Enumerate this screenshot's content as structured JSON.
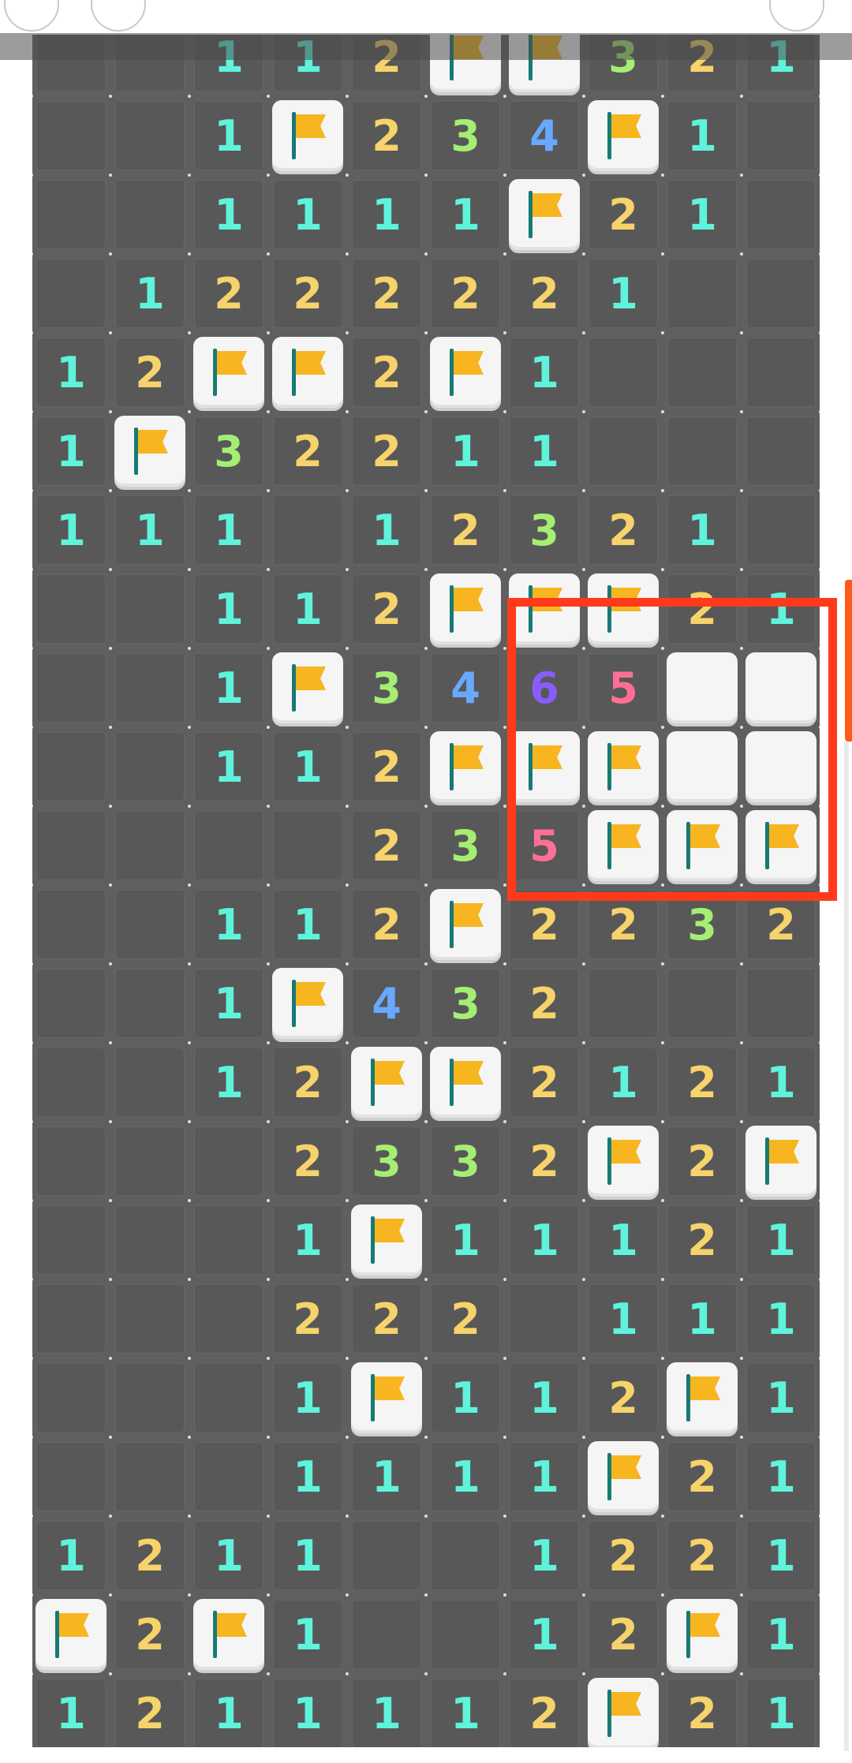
{
  "colors": {
    "1": "#5ff3dc",
    "2": "#f6d36b",
    "3": "#a5ee74",
    "4": "#68a9ff",
    "5": "#ff6f95",
    "6": "#8a5cff",
    "highlight": "#ff3a1c",
    "flag": "#f7b520"
  },
  "icon_names": {
    "flag": "flag-icon"
  },
  "board": {
    "rows": [
      [
        "",
        "",
        "1",
        "1",
        "2",
        "F",
        "F",
        "3",
        "2",
        "1"
      ],
      [
        "",
        "",
        "1",
        "F",
        "2",
        "3",
        "4",
        "F",
        "1",
        ""
      ],
      [
        "",
        "",
        "1",
        "1",
        "1",
        "1",
        "F",
        "2",
        "1",
        ""
      ],
      [
        "",
        "1",
        "2",
        "2",
        "2",
        "2",
        "2",
        "1",
        "",
        ""
      ],
      [
        "1",
        "2",
        "F",
        "F",
        "2",
        "F",
        "1",
        "",
        "",
        ""
      ],
      [
        "1",
        "F",
        "3",
        "2",
        "2",
        "1",
        "1",
        "",
        "",
        ""
      ],
      [
        "1",
        "1",
        "1",
        "",
        "1",
        "2",
        "3",
        "2",
        "1",
        ""
      ],
      [
        "",
        "",
        "1",
        "1",
        "2",
        "F",
        "F",
        "F",
        "2",
        "1"
      ],
      [
        "",
        "",
        "1",
        "F",
        "3",
        "4",
        "6",
        "5",
        "U",
        "U"
      ],
      [
        "",
        "",
        "1",
        "1",
        "2",
        "F",
        "F",
        "F",
        "U",
        "U"
      ],
      [
        "",
        "",
        "",
        "",
        "2",
        "3",
        "5",
        "F",
        "F",
        "F"
      ],
      [
        "",
        "",
        "1",
        "1",
        "2",
        "F",
        "2",
        "2",
        "3",
        "2"
      ],
      [
        "",
        "",
        "1",
        "F",
        "4",
        "3",
        "2",
        "",
        "",
        ""
      ],
      [
        "",
        "",
        "1",
        "2",
        "F",
        "F",
        "2",
        "1",
        "2",
        "1"
      ],
      [
        "",
        "",
        "",
        "2",
        "3",
        "3",
        "2",
        "F",
        "2",
        "F"
      ],
      [
        "",
        "",
        "",
        "1",
        "F",
        "1",
        "1",
        "1",
        "2",
        "1"
      ],
      [
        "",
        "",
        "",
        "2",
        "2",
        "2",
        "",
        "1",
        "1",
        "1"
      ],
      [
        "",
        "",
        "",
        "1",
        "F",
        "1",
        "1",
        "2",
        "F",
        "1"
      ],
      [
        "",
        "",
        "",
        "1",
        "1",
        "1",
        "1",
        "F",
        "2",
        "1"
      ],
      [
        "1",
        "2",
        "1",
        "1",
        "",
        "",
        "1",
        "2",
        "2",
        "1"
      ],
      [
        "F",
        "2",
        "F",
        "1",
        "",
        "",
        "1",
        "2",
        "F",
        "1"
      ],
      [
        "1",
        "2",
        "1",
        "1",
        "1",
        "1",
        "2",
        "F",
        "2",
        "1"
      ]
    ]
  }
}
